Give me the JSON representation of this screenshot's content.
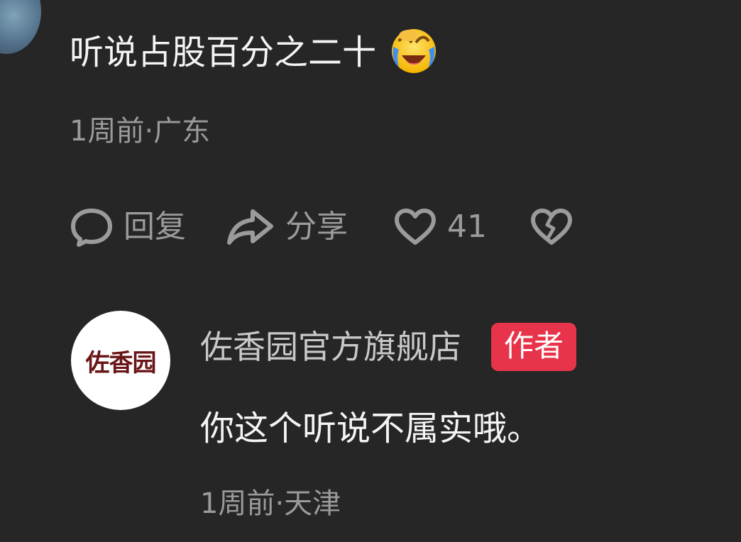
{
  "comment_1": {
    "text": "听说占股百分之二十",
    "emoji": "crying-laughing-emoji",
    "meta": "1周前·广东"
  },
  "actions": {
    "reply_label": "回复",
    "share_label": "分享",
    "like_count": "41",
    "icons": [
      "reply-icon",
      "share-icon",
      "like-icon",
      "dislike-icon"
    ]
  },
  "reply_1": {
    "author": "佐香园官方旗舰店",
    "badge": "作者",
    "avatar_logo": "佐香园",
    "text": "你这个听说不属实哦。",
    "meta": "1周前·天津"
  },
  "colors": {
    "background": "#262626",
    "badge": "#e8344a",
    "meta_text": "#9a9a9a",
    "logo": "#6a1518"
  }
}
